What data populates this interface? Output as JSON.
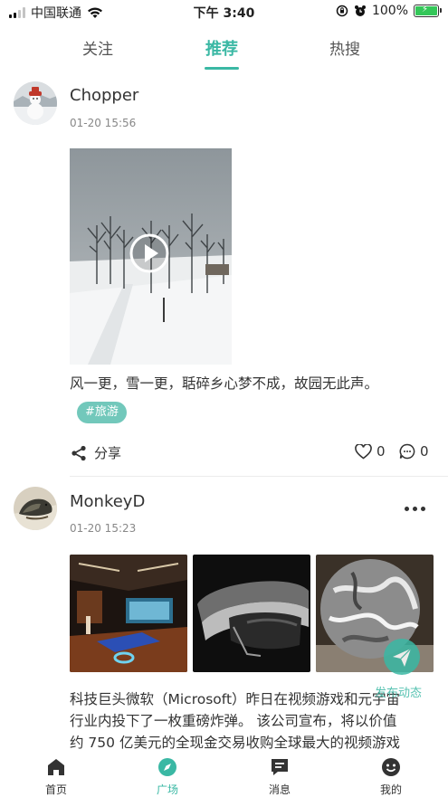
{
  "status_bar": {
    "carrier": "中国联通",
    "time": "下午 3:40",
    "battery": "100%"
  },
  "top_tabs": [
    {
      "label": "关注",
      "active": false
    },
    {
      "label": "推荐",
      "active": true
    },
    {
      "label": "热搜",
      "active": false
    }
  ],
  "posts": [
    {
      "username": "Chopper",
      "timestamp": "01-20 15:56",
      "text": "风一更，雪一更，聒碎乡心梦不成，故园无此声。",
      "tag": "#旅游",
      "share_label": "分享",
      "likes": "0",
      "comments": "0"
    },
    {
      "username": "MonkeyD",
      "timestamp": "01-20 15:23",
      "text_lines": [
        "科技巨头微软（Microsoft）昨日在视频游戏和元宇宙",
        "行业内投下了一枚重磅炸弹。 该公司宣布，将以价值",
        "约 750 亿美元的全现金交易收购全球最大的视频游戏"
      ]
    }
  ],
  "fab_label": "发布动态",
  "bottom_nav": [
    {
      "label": "首页",
      "icon": "home-icon",
      "active": false
    },
    {
      "label": "广场",
      "icon": "compass-icon",
      "active": true
    },
    {
      "label": "消息",
      "icon": "message-icon",
      "active": false
    },
    {
      "label": "我的",
      "icon": "smiley-icon",
      "active": false
    }
  ],
  "colors": {
    "accent": "#3ab8a4",
    "tag_bg": "#72c8bb",
    "text": "#333333",
    "muted": "#888888"
  }
}
